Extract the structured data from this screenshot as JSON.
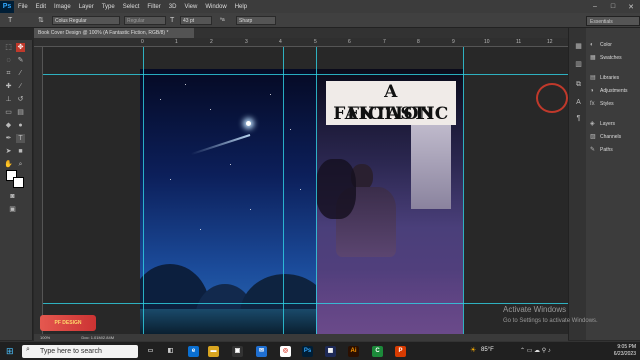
{
  "app": {
    "logo": "Ps",
    "menu": [
      "File",
      "Edit",
      "Image",
      "Layer",
      "Type",
      "Select",
      "Filter",
      "3D",
      "View",
      "Window",
      "Help"
    ],
    "window_controls": [
      "–",
      "□",
      "✕"
    ]
  },
  "options": {
    "font_family": "Colus Regular",
    "font_style": "Regular",
    "font_size": "43 pt",
    "aa_label": "ªa",
    "antialias": "Sharp",
    "workspace": "Essentials"
  },
  "document": {
    "tab_title": "Book Cover Design @ 100% (A Fantastic  Fiction, RGB/8) *",
    "zoom": "100%",
    "doc_size": "Doc: 1.01M/2.84M"
  },
  "ruler_ticks": [
    "0",
    "1",
    "2",
    "3",
    "4",
    "5",
    "6",
    "7",
    "8",
    "9",
    "10",
    "11",
    "12"
  ],
  "cover": {
    "title_line1": "A FANTASTIC",
    "title_line2": "FICTION"
  },
  "panels": {
    "items": [
      {
        "label": "Color",
        "icon": "color-icon"
      },
      {
        "label": "Swatches",
        "icon": "swatches-icon"
      },
      {
        "label": "Libraries",
        "icon": "libraries-icon"
      },
      {
        "label": "Adjustments",
        "icon": "adjustments-icon"
      },
      {
        "label": "Styles",
        "icon": "styles-icon"
      },
      {
        "label": "Layers",
        "icon": "layers-icon"
      },
      {
        "label": "Channels",
        "icon": "channels-icon"
      },
      {
        "label": "Paths",
        "icon": "paths-icon"
      }
    ]
  },
  "watermark": {
    "line1": "Activate Windows",
    "line2": "Go to Settings to activate Windows."
  },
  "brand": "PF DESIGN",
  "taskbar": {
    "search_placeholder": "Type here to search",
    "weather": "85°F",
    "time": "9:05 PM",
    "date": "6/23/2023"
  }
}
